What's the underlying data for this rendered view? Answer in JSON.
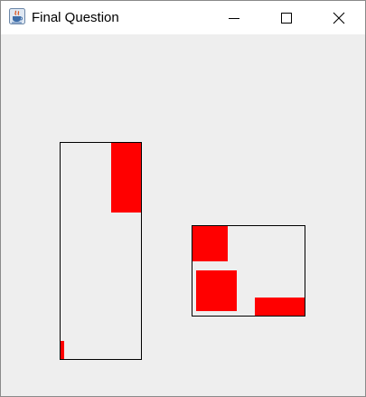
{
  "window": {
    "title": "Final Question",
    "app_icon": "java-cup-icon"
  },
  "title_controls": {
    "minimize": "minimize-icon",
    "maximize": "maximize-icon",
    "close": "close-icon"
  },
  "colors": {
    "window_bg": "#eeeeee",
    "titlebar_bg": "#ffffff",
    "panel_border": "#000000",
    "shape_fill": "#ff0000"
  }
}
